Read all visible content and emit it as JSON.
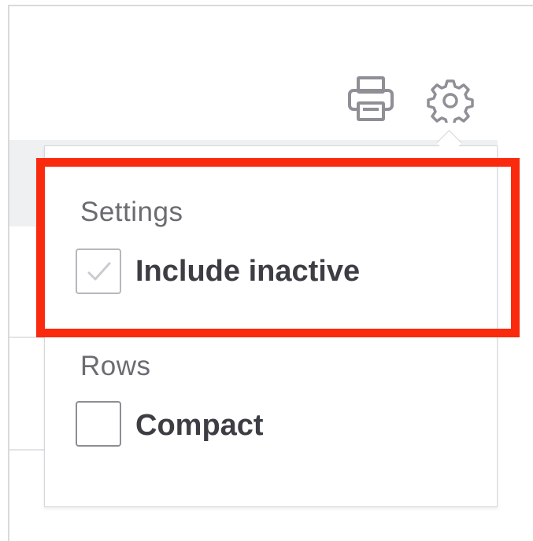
{
  "toolbar": {
    "print_icon": "print-icon",
    "settings_icon": "gear-icon"
  },
  "settings_menu": {
    "settings_section": {
      "title": "Settings",
      "options": [
        {
          "label": "Include inactive",
          "checked": true,
          "disabled_appearance": true
        }
      ]
    },
    "rows_section": {
      "title": "Rows",
      "options": [
        {
          "label": "Compact",
          "checked": false
        }
      ]
    }
  },
  "colors": {
    "highlight": "#fa2a0e",
    "text_muted": "#6b6c72",
    "text_strong": "#3d3e44",
    "icon": "#8e9096",
    "header_band": "#eef0f2"
  }
}
